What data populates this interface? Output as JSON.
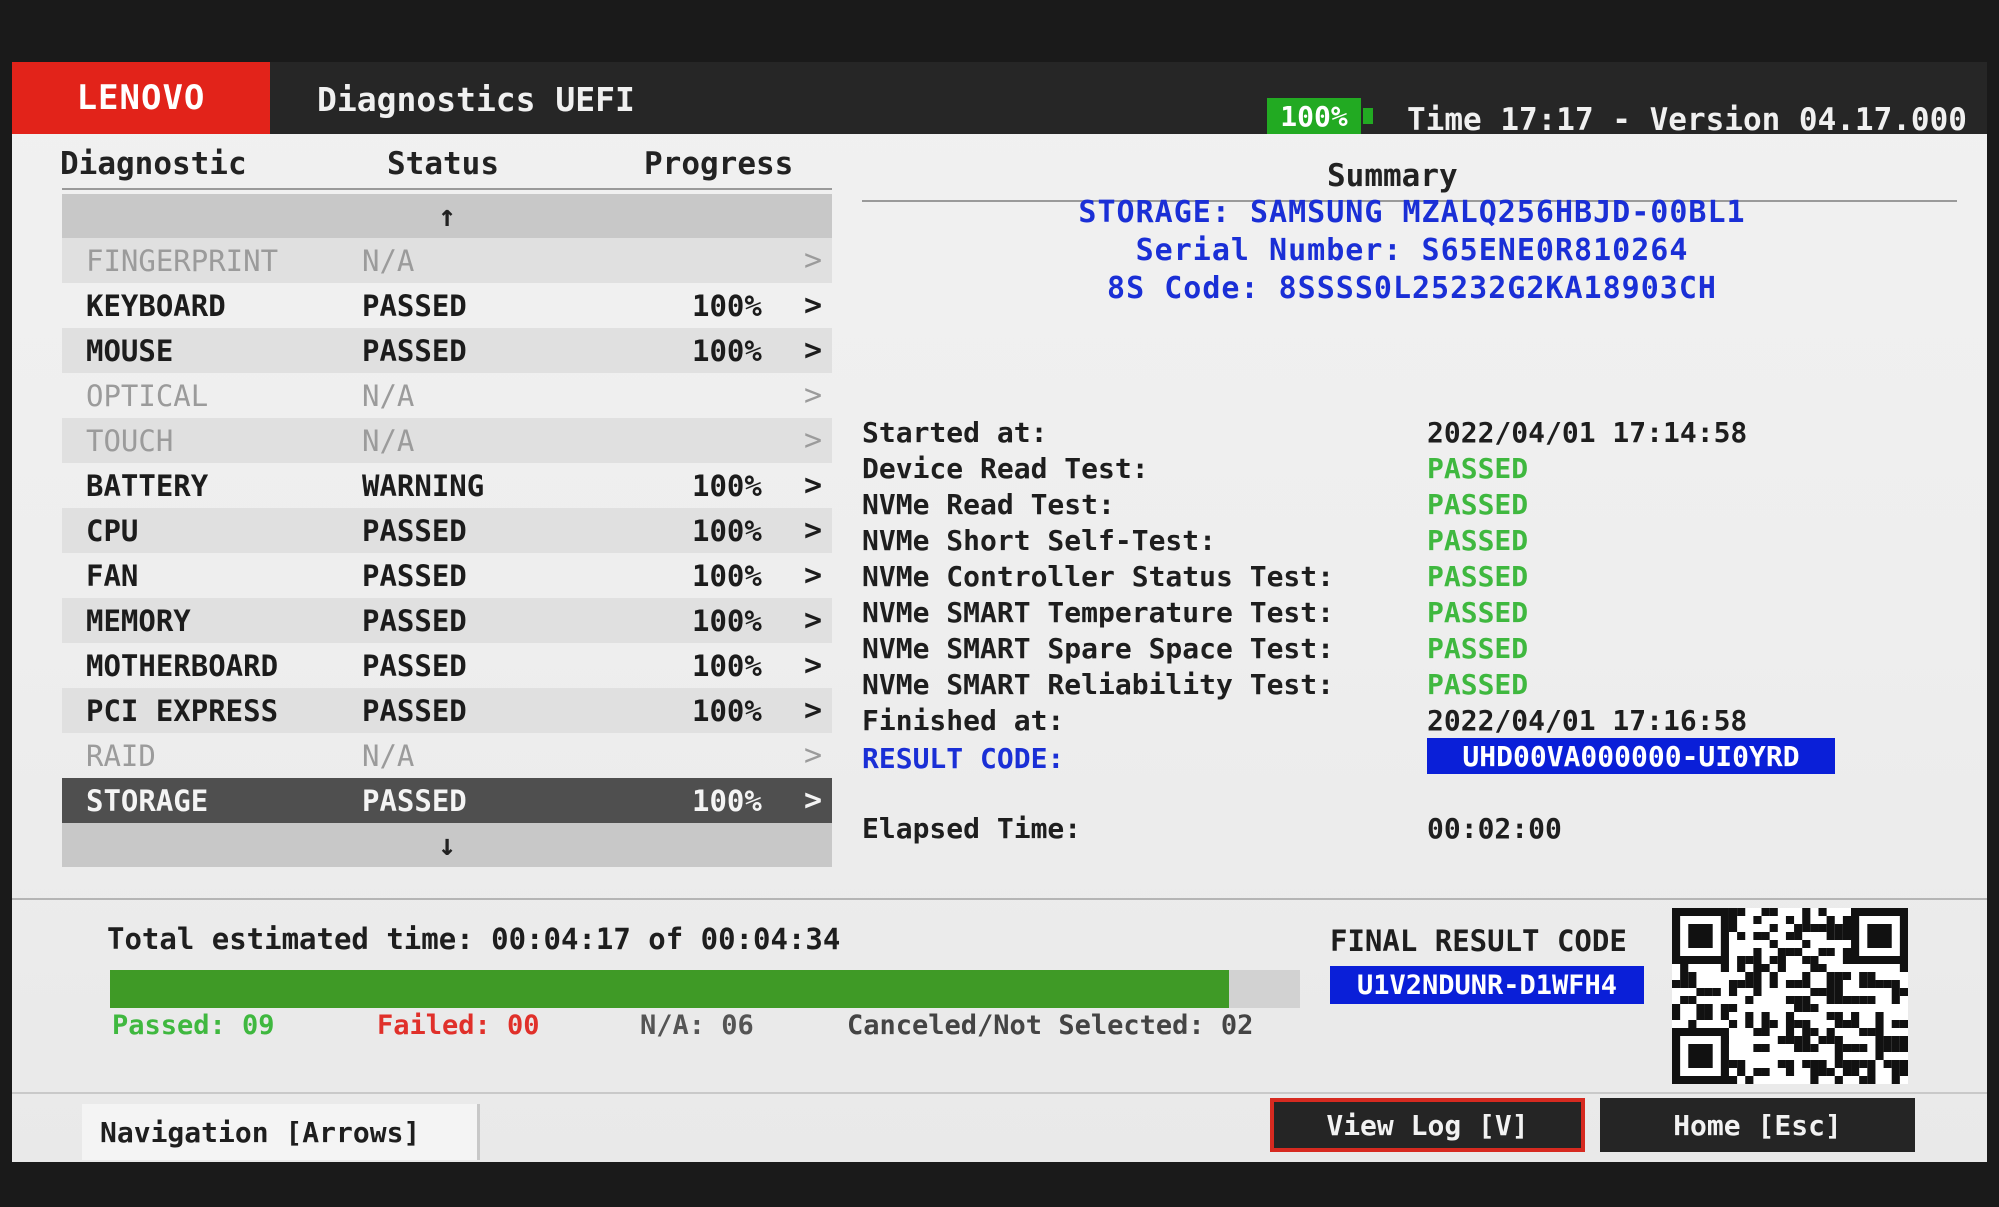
{
  "header": {
    "logo": "LENOVO",
    "title": "Diagnostics UEFI",
    "battery": "100%",
    "time_version": "Time 17:17 - Version 04.17.000"
  },
  "columns": {
    "diagnostic": "Diagnostic",
    "status": "Status",
    "progress": "Progress",
    "summary": "Summary"
  },
  "list": {
    "up_arrow": "↑",
    "down_arrow": "↓",
    "items": [
      {
        "name": "FINGERPRINT",
        "status": "N/A",
        "progress": "",
        "chevron": ">"
      },
      {
        "name": "KEYBOARD",
        "status": "PASSED",
        "progress": "100%",
        "chevron": ">"
      },
      {
        "name": "MOUSE",
        "status": "PASSED",
        "progress": "100%",
        "chevron": ">"
      },
      {
        "name": "OPTICAL",
        "status": "N/A",
        "progress": "",
        "chevron": ">"
      },
      {
        "name": "TOUCH",
        "status": "N/A",
        "progress": "",
        "chevron": ">"
      },
      {
        "name": "BATTERY",
        "status": "WARNING",
        "progress": "100%",
        "chevron": ">"
      },
      {
        "name": "CPU",
        "status": "PASSED",
        "progress": "100%",
        "chevron": ">"
      },
      {
        "name": "FAN",
        "status": "PASSED",
        "progress": "100%",
        "chevron": ">"
      },
      {
        "name": "MEMORY",
        "status": "PASSED",
        "progress": "100%",
        "chevron": ">"
      },
      {
        "name": "MOTHERBOARD",
        "status": "PASSED",
        "progress": "100%",
        "chevron": ">"
      },
      {
        "name": "PCI EXPRESS",
        "status": "PASSED",
        "progress": "100%",
        "chevron": ">"
      },
      {
        "name": "RAID",
        "status": "N/A",
        "progress": "",
        "chevron": ">"
      },
      {
        "name": "STORAGE",
        "status": "PASSED",
        "progress": "100%",
        "chevron": ">"
      }
    ]
  },
  "summary": {
    "storage": "STORAGE: SAMSUNG MZALQ256HBJD-00BL1",
    "serial": "Serial Number: S65ENE0R810264",
    "code_8s": "8S Code: 8SSSS0L25232G2KA18903CH",
    "started_label": "Started at:",
    "started_value": "2022/04/01 17:14:58",
    "tests": [
      {
        "label": "Device Read Test:",
        "result": "PASSED"
      },
      {
        "label": "NVMe Read Test:",
        "result": "PASSED"
      },
      {
        "label": "NVMe Short Self-Test:",
        "result": "PASSED"
      },
      {
        "label": "NVMe Controller Status Test:",
        "result": "PASSED"
      },
      {
        "label": "NVMe SMART Temperature Test:",
        "result": "PASSED"
      },
      {
        "label": "NVMe SMART Spare Space Test:",
        "result": "PASSED"
      },
      {
        "label": "NVMe SMART Reliability Test:",
        "result": "PASSED"
      }
    ],
    "finished_label": "Finished at:",
    "finished_value": "2022/04/01 17:16:58",
    "result_code_label": "RESULT CODE:",
    "result_code_value": "UHD00VA000000-UI0YRD",
    "elapsed_label": "Elapsed Time:",
    "elapsed_value": "00:02:00"
  },
  "status": {
    "total_time": "Total estimated time: 00:04:17 of 00:04:34",
    "progress_fraction": 0.94,
    "passed": "Passed: 09",
    "failed": "Failed: 00",
    "na": "N/A: 06",
    "canceled": "Canceled/Not Selected: 02",
    "final_label": "FINAL RESULT CODE",
    "final_code": "U1V2NDUNR-D1WFH4"
  },
  "footer": {
    "navigation": "Navigation [Arrows]",
    "view_log": "View Log [V]",
    "home": "Home [Esc]"
  },
  "colors": {
    "lenovo_red": "#e2231a",
    "passed_green": "#3fb83f",
    "failed_red": "#e0302a",
    "summary_blue": "#1a2fd6",
    "code_bg_blue": "#0a1fd8",
    "progress_green": "#3f9a26"
  },
  "icons": {
    "cursor": "mouse-pointer-icon",
    "up": "arrow-up-icon",
    "down": "arrow-down-icon",
    "chevron": "chevron-right-icon",
    "qr": "qr-code-icon"
  }
}
